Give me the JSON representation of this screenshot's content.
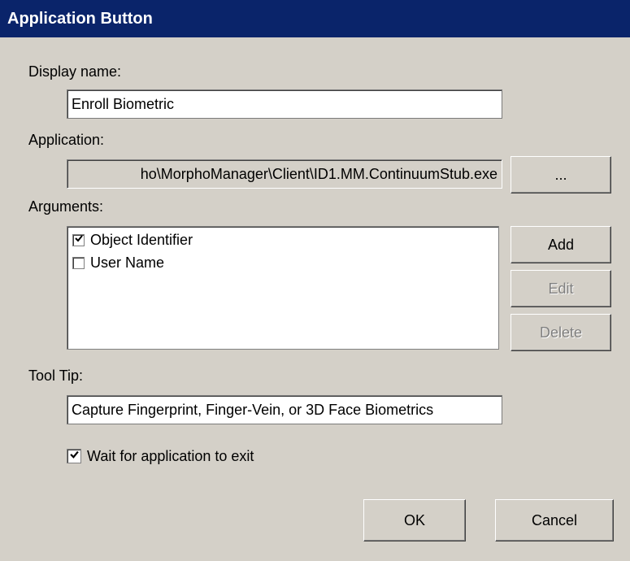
{
  "dialog": {
    "title": "Application Button"
  },
  "display_name": {
    "label": "Display name:",
    "value": "Enroll Biometric"
  },
  "application": {
    "label": "Application:",
    "value": "ho\\MorphoManager\\Client\\ID1.MM.ContinuumStub.exe",
    "browse_label": "..."
  },
  "arguments": {
    "label": "Arguments:",
    "items": [
      {
        "label": "Object Identifier",
        "checked": true
      },
      {
        "label": "User Name",
        "checked": false
      }
    ],
    "add_label": "Add",
    "edit_label": "Edit",
    "delete_label": "Delete"
  },
  "tooltip": {
    "label": "Tool Tip:",
    "value": "Capture Fingerprint, Finger-Vein, or 3D Face Biometrics"
  },
  "wait": {
    "label": "Wait for application to exit",
    "checked": true
  },
  "footer": {
    "ok_label": "OK",
    "cancel_label": "Cancel"
  },
  "colors": {
    "titlebar": "#0a246a",
    "dialog_face": "#d4d0c8"
  },
  "icons": {
    "checkmark": "check-icon"
  }
}
